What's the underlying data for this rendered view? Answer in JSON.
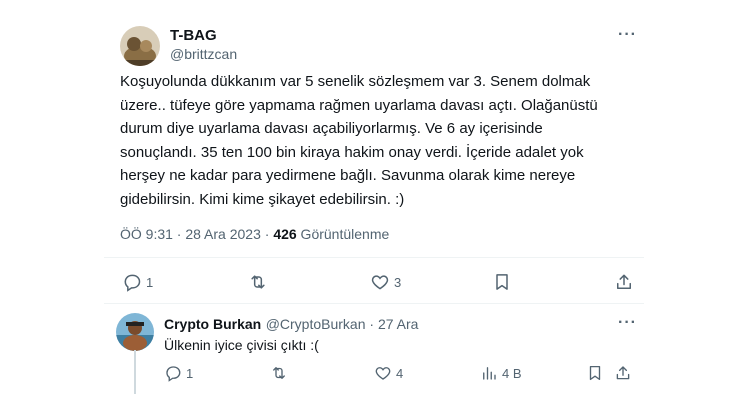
{
  "tweet": {
    "name": "T-BAG",
    "handle": "@brittzcan",
    "text": "Koşuyolunda dükkanım var 5 senelik sözleşmem var 3. Senem dolmak\nüzere.. tüfeye göre yapmama rağmen uyarlama davası açtı. Olağanüstü\ndurum diye uyarlama davası açabiliyorlarmış. Ve 6 ay içerisinde\nsonuçlandı. 35 ten 100 bin kiraya hakim onay verdi. İçeride adalet yok\nherşey ne kadar para yedirmene bağlı. Savunma olarak kime nereye\ngidebilirsin. Kimi kime şikayet edebilirsin. :)",
    "time": "ÖÖ 9:31 · 28 Ara 2023 · ",
    "views_count": "426",
    "views_label": " Görüntülenme",
    "actions": {
      "reply_count": "1",
      "retweet_count": "",
      "like_count": "3"
    },
    "more_label": "···"
  },
  "reply": {
    "name": "Crypto Burkan",
    "handle": "@CryptoBurkan",
    "date": " · 27 Ara",
    "text": "Ülkenin iyice çivisi çıktı :(",
    "actions": {
      "reply_count": "1",
      "retweet_count": "",
      "like_count": "4",
      "views_count": "4 B"
    },
    "more_label": "···"
  },
  "colors": {
    "muted": "#536471",
    "text": "#0f1419",
    "divider": "#eff3f4"
  }
}
